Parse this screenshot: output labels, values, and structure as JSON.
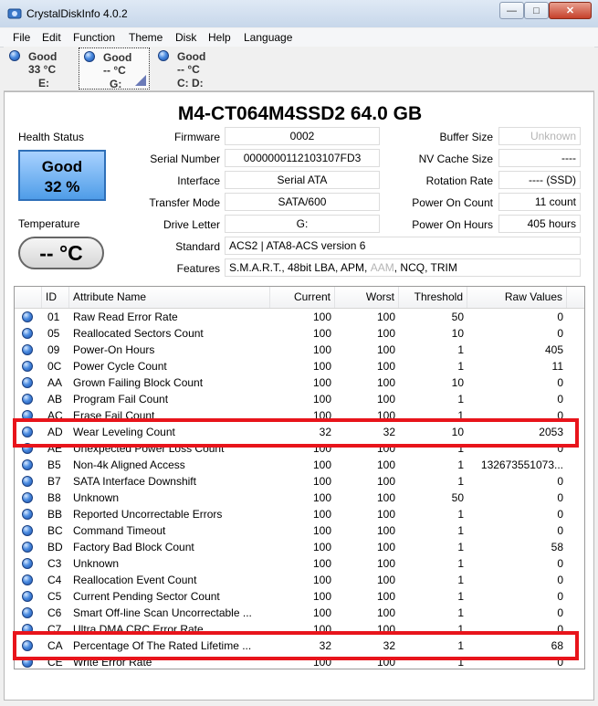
{
  "window": {
    "title": "CrystalDiskInfo 4.0.2",
    "controls": {
      "minimize": "—",
      "maximize": "□",
      "close": "✕"
    }
  },
  "menu": [
    "File",
    "Edit",
    "Function",
    "Theme",
    "Disk",
    "Help",
    "Language"
  ],
  "drives": [
    {
      "status": "Good",
      "temp": "33 °C",
      "letter": "E:"
    },
    {
      "status": "Good",
      "temp": "-- °C",
      "letter": "G:"
    },
    {
      "status": "Good",
      "temp": "-- °C",
      "letter": "C: D:"
    }
  ],
  "disk": {
    "title": "M4-CT064M4SSD2  64.0 GB"
  },
  "health": {
    "label": "Health Status",
    "status": "Good",
    "percent": "32 %",
    "color": "#4f9de8"
  },
  "temperature": {
    "label": "Temperature",
    "value": "-- °C"
  },
  "fields": {
    "firmware": {
      "label": "Firmware",
      "value": "0002"
    },
    "serial": {
      "label": "Serial Number",
      "value": "0000000112103107FD3"
    },
    "interface": {
      "label": "Interface",
      "value": "Serial ATA"
    },
    "transfer": {
      "label": "Transfer Mode",
      "value": "SATA/600"
    },
    "drive_letter": {
      "label": "Drive Letter",
      "value": "G:"
    },
    "buffer": {
      "label": "Buffer Size",
      "value": "Unknown"
    },
    "nvcache": {
      "label": "NV Cache Size",
      "value": "----"
    },
    "rotation": {
      "label": "Rotation Rate",
      "value": "---- (SSD)"
    },
    "power_count": {
      "label": "Power On Count",
      "value": "11 count"
    },
    "power_hours": {
      "label": "Power On Hours",
      "value": "405 hours"
    },
    "standard": {
      "label": "Standard",
      "value": "ACS2 | ATA8-ACS version 6"
    },
    "features": {
      "label": "Features",
      "pre": "S.M.A.R.T., 48bit LBA, APM, ",
      "aam": "AAM",
      "post": ", NCQ, TRIM"
    }
  },
  "table": {
    "headers": {
      "id": "ID",
      "name": "Attribute Name",
      "current": "Current",
      "worst": "Worst",
      "threshold": "Threshold",
      "raw": "Raw Values"
    },
    "rows": [
      {
        "id": "01",
        "name": "Raw Read Error Rate",
        "current": "100",
        "worst": "100",
        "threshold": "50",
        "raw": "0"
      },
      {
        "id": "05",
        "name": "Reallocated Sectors Count",
        "current": "100",
        "worst": "100",
        "threshold": "10",
        "raw": "0"
      },
      {
        "id": "09",
        "name": "Power-On Hours",
        "current": "100",
        "worst": "100",
        "threshold": "1",
        "raw": "405"
      },
      {
        "id": "0C",
        "name": "Power Cycle Count",
        "current": "100",
        "worst": "100",
        "threshold": "1",
        "raw": "11"
      },
      {
        "id": "AA",
        "name": "Grown Failing Block Count",
        "current": "100",
        "worst": "100",
        "threshold": "10",
        "raw": "0"
      },
      {
        "id": "AB",
        "name": "Program Fail Count",
        "current": "100",
        "worst": "100",
        "threshold": "1",
        "raw": "0"
      },
      {
        "id": "AC",
        "name": "Erase Fail Count",
        "current": "100",
        "worst": "100",
        "threshold": "1",
        "raw": "0"
      },
      {
        "id": "AD",
        "name": "Wear Leveling Count",
        "current": "32",
        "worst": "32",
        "threshold": "10",
        "raw": "2053"
      },
      {
        "id": "AE",
        "name": "Unexpected Power Loss Count",
        "current": "100",
        "worst": "100",
        "threshold": "1",
        "raw": "0"
      },
      {
        "id": "B5",
        "name": "Non-4k Aligned Access",
        "current": "100",
        "worst": "100",
        "threshold": "1",
        "raw": "132673551073..."
      },
      {
        "id": "B7",
        "name": "SATA Interface Downshift",
        "current": "100",
        "worst": "100",
        "threshold": "1",
        "raw": "0"
      },
      {
        "id": "B8",
        "name": "Unknown",
        "current": "100",
        "worst": "100",
        "threshold": "50",
        "raw": "0"
      },
      {
        "id": "BB",
        "name": "Reported Uncorrectable Errors",
        "current": "100",
        "worst": "100",
        "threshold": "1",
        "raw": "0"
      },
      {
        "id": "BC",
        "name": "Command Timeout",
        "current": "100",
        "worst": "100",
        "threshold": "1",
        "raw": "0"
      },
      {
        "id": "BD",
        "name": "Factory Bad Block Count",
        "current": "100",
        "worst": "100",
        "threshold": "1",
        "raw": "58"
      },
      {
        "id": "C3",
        "name": "Unknown",
        "current": "100",
        "worst": "100",
        "threshold": "1",
        "raw": "0"
      },
      {
        "id": "C4",
        "name": "Reallocation Event Count",
        "current": "100",
        "worst": "100",
        "threshold": "1",
        "raw": "0"
      },
      {
        "id": "C5",
        "name": "Current Pending Sector Count",
        "current": "100",
        "worst": "100",
        "threshold": "1",
        "raw": "0"
      },
      {
        "id": "C6",
        "name": "Smart Off-line Scan Uncorrectable ...",
        "current": "100",
        "worst": "100",
        "threshold": "1",
        "raw": "0"
      },
      {
        "id": "C7",
        "name": "Ultra DMA CRC Error Rate",
        "current": "100",
        "worst": "100",
        "threshold": "1",
        "raw": "0"
      },
      {
        "id": "CA",
        "name": "Percentage Of The Rated Lifetime ...",
        "current": "32",
        "worst": "32",
        "threshold": "1",
        "raw": "68"
      },
      {
        "id": "CE",
        "name": "Write Error Rate",
        "current": "100",
        "worst": "100",
        "threshold": "1",
        "raw": "0"
      }
    ]
  },
  "highlight_color": "#e8141b"
}
